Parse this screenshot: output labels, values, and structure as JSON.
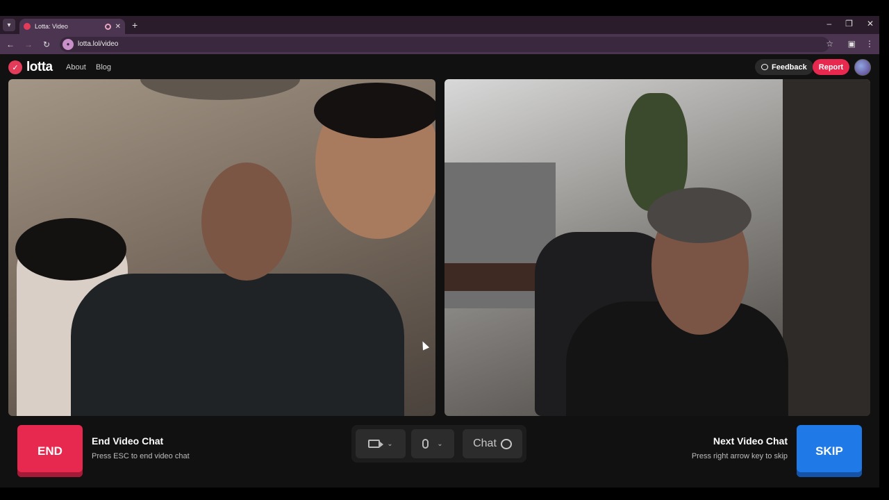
{
  "browser": {
    "tab_title": "Lotta: Video",
    "url": "lotta.lol/video"
  },
  "header": {
    "logo_text": "lotta",
    "nav": [
      "About",
      "Blog"
    ],
    "feedback_label": "Feedback",
    "report_label": "Report"
  },
  "controls": {
    "end_label": "END",
    "end_title": "End Video Chat",
    "end_hint": "Press ESC to end video chat",
    "chat_label": "Chat",
    "next_title": "Next Video Chat",
    "next_hint": "Press right arrow key to skip",
    "skip_label": "SKIP"
  },
  "colors": {
    "accent_red": "#e8294f",
    "accent_blue": "#1f7ae8",
    "app_bg": "#111111"
  }
}
